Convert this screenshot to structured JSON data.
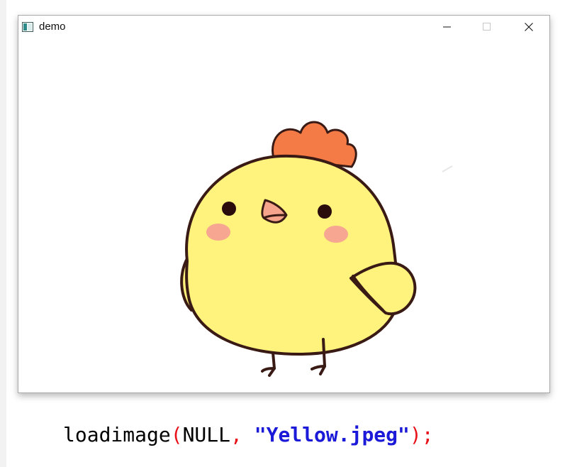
{
  "window": {
    "title": "demo",
    "controls": {
      "minimize": "minimize-icon",
      "maximize": "maximize-icon",
      "close": "close-icon"
    }
  },
  "image": {
    "subject": "yellow-chick-illustration",
    "colors": {
      "body": "#fff27d",
      "outline": "#3a1a14",
      "comb": "#f47a46",
      "cheeks": "#f7a691",
      "beak": "#f6a58c"
    }
  },
  "code": {
    "func": "loadimage",
    "open_paren": "(",
    "arg1": "NULL",
    "comma": ",",
    "space": " ",
    "arg2": "\"Yellow.jpeg\"",
    "close": ");"
  },
  "colors": {
    "paren": "#e8131a",
    "string": "#1a1ad8"
  }
}
